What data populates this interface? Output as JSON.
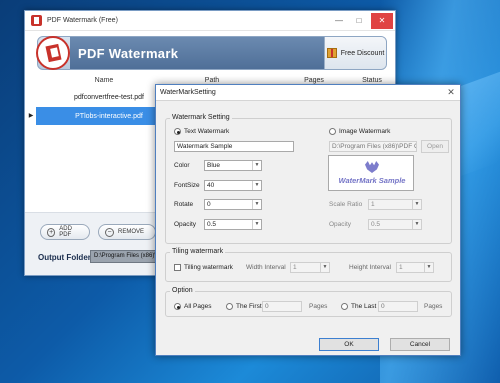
{
  "main_window": {
    "title": "PDF Watermark (Free)",
    "banner_title": "PDF Watermark",
    "free_discount": "Free Discount",
    "columns": [
      "Name",
      "Path",
      "Pages",
      "Status"
    ],
    "files": [
      {
        "name": "pdfconvertfree-test.pdf",
        "selected": false
      },
      {
        "name": "PTlobs-interactive.pdf",
        "selected": true
      }
    ],
    "add_pdf": "ADD PDF",
    "remove": "REMOVE",
    "output_folder_label": "Output Folder",
    "output_folder_value": "D:\\Program Files (x86)\\"
  },
  "dialog": {
    "title": "WaterMarkSetting",
    "watermark_setting": {
      "group_label": "Watermark Setting",
      "text_watermark_label": "Text Watermark",
      "image_watermark_label": "Image Watermark",
      "text_value": "Watermark Sample",
      "image_path": "D:\\Program Files (x86)\\PDF Co",
      "open_label": "Open",
      "color_label": "Color",
      "color_value": "Blue",
      "fontsize_label": "FontSize",
      "fontsize_value": "40",
      "rotate_label": "Rotate",
      "rotate_value": "0",
      "opacity_label": "Opacity",
      "opacity_value": "0.5",
      "preview_text": "WaterMark Sample",
      "scale_ratio_label": "Scale Ratio",
      "scale_ratio_value": "1",
      "image_opacity_label": "Opacity",
      "image_opacity_value": "0.5"
    },
    "tiling": {
      "group_label": "Tiling watermark",
      "checkbox_label": "Tilling watermark",
      "width_interval_label": "Width Interval",
      "width_interval_value": "1",
      "height_interval_label": "Height Interval",
      "height_interval_value": "1"
    },
    "option": {
      "group_label": "Option",
      "all_pages_label": "All Pages",
      "the_first_label": "The First",
      "the_first_value": "0",
      "pages_label_1": "Pages",
      "the_last_label": "The Last",
      "the_last_value": "0",
      "pages_label_2": "Pages"
    },
    "ok_label": "OK",
    "cancel_label": "Cancel"
  }
}
